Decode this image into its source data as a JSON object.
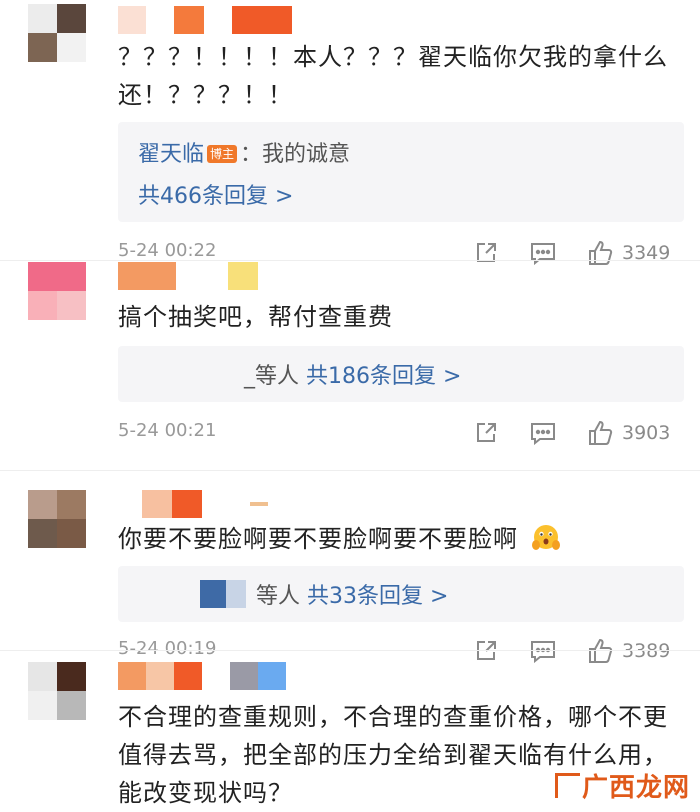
{
  "comments": [
    {
      "text": "？？？！！！！本人？？？翟天临你欠我的拿什么还！？？？！！",
      "reply_author": "翟天临",
      "reply_badge": "博主",
      "reply_text": "：我的诚意",
      "reply_count_label": "共466条回复 >",
      "time": "5-24 00:22",
      "likes": "3349"
    },
    {
      "text": "搞个抽奖吧，帮付查重费",
      "reply_prefix": "_等人",
      "reply_count_label": "共186条回复 >",
      "time": "5-24 00:21",
      "likes": "3903"
    },
    {
      "text": "你要不要脸啊要不要脸啊要不要脸啊",
      "reply_prefix": "等人",
      "reply_count_label": "共33条回复 >",
      "time": "5-24 00:19",
      "likes": "3389"
    },
    {
      "text": "不合理的查重规则，不合理的查重价格，哪个不更值得去骂，把全部的压力全给到翟天临有什么用，能改变现状吗？"
    }
  ],
  "emoji": "face-with-hands-on-cheeks-emoji",
  "watermark": "广西龙网",
  "colors": {
    "link": "#3a6aa8",
    "badge": "#f0782a",
    "meta": "#999999",
    "watermark": "#e05a1a"
  }
}
